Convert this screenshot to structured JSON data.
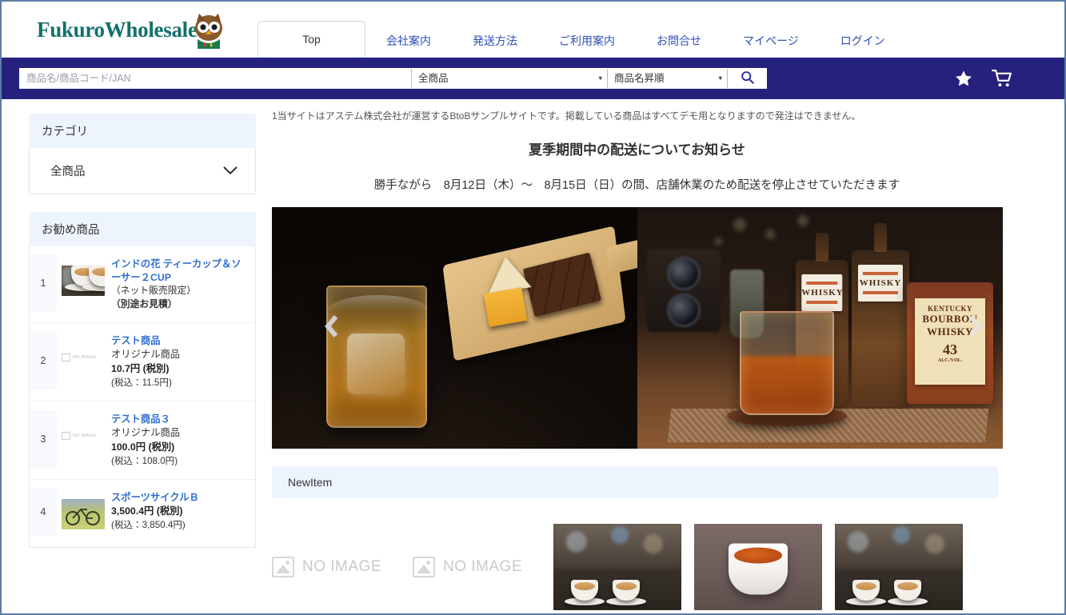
{
  "brand": {
    "logo_text": "FukuroWholesale",
    "logo_color": "#13716b",
    "mascot": "owl-mascot"
  },
  "nav": {
    "items": [
      {
        "label": "Top",
        "active": true
      },
      {
        "label": "会社案内",
        "active": false
      },
      {
        "label": "発送方法",
        "active": false
      },
      {
        "label": "ご利用案内",
        "active": false
      },
      {
        "label": "お問合せ",
        "active": false
      },
      {
        "label": "マイページ",
        "active": false
      },
      {
        "label": "ログイン",
        "active": false
      }
    ]
  },
  "search": {
    "placeholder": "商品名/商品コード/JAN",
    "value": "",
    "category_selected": "全商品",
    "sort_selected": "商品名昇順",
    "bar_color": "#26217c",
    "search_icon": "search-icon",
    "favorite_icon": "star-icon",
    "cart_icon": "cart-icon"
  },
  "sidebar": {
    "category": {
      "title": "カテゴリ",
      "selected": "全商品",
      "chevron": "chevron-down-icon"
    },
    "recommended": {
      "title": "お勧め商品",
      "items": [
        {
          "rank": "1",
          "name": "インドの花 ティーカップ＆ソーサー２CUP",
          "note": "（ネット販売限定）",
          "note_bold": "（別途お見積）",
          "sub": "",
          "price": "",
          "price_tax": "",
          "thumb": "coffee-cups-photo"
        },
        {
          "rank": "2",
          "name": "テスト商品",
          "sub": "オリジナル商品",
          "price": "10.7円 (税別)",
          "price_tax": "(税込：11.5円)",
          "thumb": "no-image"
        },
        {
          "rank": "3",
          "name": "テスト商品３",
          "sub": "オリジナル商品",
          "price": "100.0円 (税別)",
          "price_tax": "(税込：108.0円)",
          "thumb": "no-image"
        },
        {
          "rank": "4",
          "name": "スポーツサイクルＢ",
          "sub": "",
          "price": "3,500.4円 (税別)",
          "price_tax": "(税込：3,850.4円)",
          "thumb": "bicycle-photo"
        }
      ]
    }
  },
  "main": {
    "notice_small": "1当サイトはアステム株式会社が運営するBtoBサンプルサイトです。掲載している商品はすべてデモ用となりますので発注はできません。",
    "notice_title": "夏季期間中の配送についてお知らせ",
    "notice_body": "勝手ながら　8月12日（木）～　8月15日（日）の間、店舗休業のため配送を停止させていただきます",
    "carousel": {
      "prev_icon": "chevron-left-icon",
      "next_icon": "chevron-right-icon",
      "slides": [
        {
          "alt": "whiskey-glass-cheese-board-photo"
        },
        {
          "alt": "bourbon-whisky-bottles-photo"
        }
      ],
      "slide2_labels": {
        "bottle1": "WHISKY",
        "bottle2": "WHISKY",
        "stamp_line1": "KENTUCKY",
        "stamp_line2": "BOURBON",
        "stamp_line3": "WHISKY",
        "stamp_abv": "43",
        "stamp_alc": "ALC./VOL."
      }
    },
    "newitem": {
      "title": "NewItem",
      "cells": [
        {
          "type": "no-image",
          "label": "NO IMAGE"
        },
        {
          "type": "no-image",
          "label": "NO IMAGE"
        },
        {
          "type": "image",
          "alt": "cafe-latte-cups-photo"
        },
        {
          "type": "image",
          "alt": "white-teacup-photo"
        },
        {
          "type": "image",
          "alt": "cafe-latte-cups-photo"
        }
      ]
    }
  }
}
